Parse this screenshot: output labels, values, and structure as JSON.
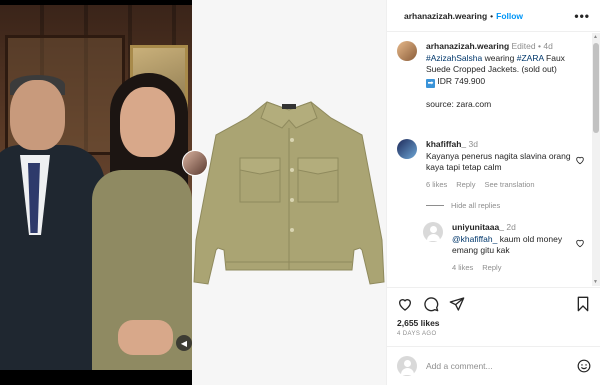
{
  "post": {
    "username": "arhanazizah.wearing",
    "separator": "•",
    "follow_label": "Follow",
    "more_label": "•••"
  },
  "caption": {
    "username": "arhanazizah.wearing",
    "edited": "Edited",
    "dot": "•",
    "time": "4d",
    "tag1": "#AzizahSalsha",
    "word1": " wearing ",
    "tag2": "#ZARA",
    "desc": " Faux Suede Cropped Jackets. (sold out)",
    "arrow_icon": "➡",
    "price": " IDR 749.900",
    "source": "source: zara.com"
  },
  "comments": [
    {
      "username": "khafiffah_",
      "time": "3d",
      "text": "Kayanya penerus nagita slavina orang kaya tapi tetap calm",
      "likes": "6 likes",
      "reply": "Reply",
      "translate": "See translation"
    },
    {
      "username": "uniyunitaaa_",
      "time": "2d",
      "mention": "@khafiffah_",
      "text": " kaum old money emang gitu kak",
      "likes": "4 likes",
      "reply": "Reply"
    }
  ],
  "hide_replies": "Hide all replies",
  "likes_count": "2,655 likes",
  "date": "4 DAYS AGO",
  "add_comment_placeholder": "Add a comment...",
  "colors": {
    "accent": "#0095f6",
    "tag": "#00376b",
    "jacket": "#a8a372",
    "muted": "#8e8e8e"
  },
  "icons": [
    "heart-icon",
    "comment-icon",
    "share-icon",
    "bookmark-icon",
    "emoji-icon",
    "more-icon",
    "sound-icon"
  ]
}
